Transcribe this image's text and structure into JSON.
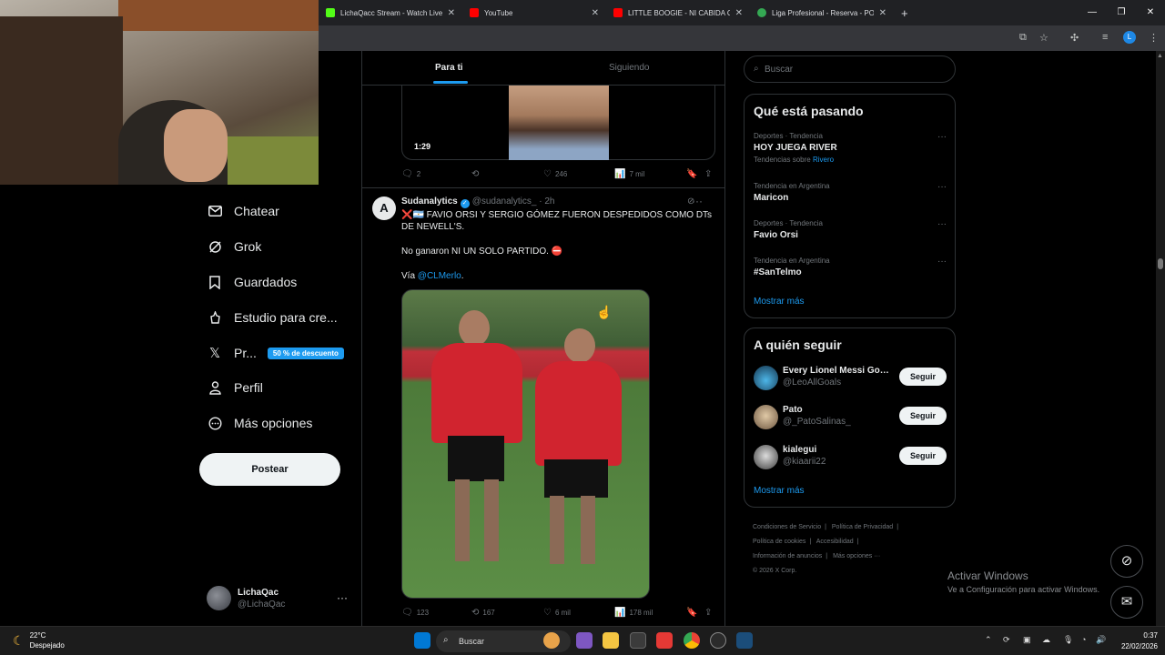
{
  "browser": {
    "tabs": [
      {
        "title": "LichaQacc Stream - Watch Live",
        "color": "#53fc18"
      },
      {
        "title": "YouTube",
        "color": "#ff0000"
      },
      {
        "title": "LITTLE BOOGIE - NI CABIDA CO",
        "color": "#ff0000"
      },
      {
        "title": "Liga Profesional - Reserva - PO",
        "color": "#34a853"
      }
    ],
    "new_tab": "+",
    "profile_initial": "L"
  },
  "nav": {
    "items": [
      {
        "label": "Chatear",
        "icon": "envelope-icon"
      },
      {
        "label": "Grok",
        "icon": "grok-icon"
      },
      {
        "label": "Guardados",
        "icon": "bookmark-icon"
      },
      {
        "label": "Estudio para cre...",
        "icon": "creator-studio-icon"
      },
      {
        "label": "Pr...",
        "icon": "x-logo-icon",
        "badge": "50 % de descuento"
      },
      {
        "label": "Perfil",
        "icon": "person-icon"
      },
      {
        "label": "Más opciones",
        "icon": "more-circle-icon"
      }
    ],
    "post_label": "Postear",
    "account": {
      "name": "LichaQac",
      "handle": "@LichaQac"
    }
  },
  "feed": {
    "tabs": {
      "active": "Para ti",
      "inactive": "Siguiendo"
    },
    "prev_post": {
      "video_time": "1:29",
      "replies": "2",
      "likes": "246",
      "views": "7 mil"
    },
    "post": {
      "avatar_letter": "A",
      "author": "Sudanalytics",
      "handle": "@sudanalytics_",
      "time": "· 2h",
      "line1": "❌🇦🇷 FAVIO ORSI Y SERGIO GÓMEZ FUERON DESPEDIDOS COMO DTs DE NEWELL'S.",
      "line2": "No ganaron NI UN SOLO PARTIDO. ⛔",
      "via_prefix": "Vía ",
      "via_link": "@CLMerlo",
      "via_suffix": ".",
      "replies": "123",
      "reposts": "167",
      "likes": "6 mil",
      "views": "178 mil"
    }
  },
  "search": {
    "placeholder": "Buscar"
  },
  "trends": {
    "title": "Qué está pasando",
    "items": [
      {
        "context": "Deportes · Tendencia",
        "title": "HOY JUEGA RIVER",
        "sub_prefix": "Tendencias sobre ",
        "sub_link": "Rivero"
      },
      {
        "context": "Tendencia en Argentina",
        "title": "Maricon"
      },
      {
        "context": "Deportes · Tendencia",
        "title": "Favio Orsi"
      },
      {
        "context": "Tendencia en Argentina",
        "title": "#SanTelmo"
      }
    ],
    "show_more": "Mostrar más"
  },
  "who_to_follow": {
    "title": "A quién seguir",
    "items": [
      {
        "name": "Every Lionel Messi Goa...",
        "handle": "@LeoAllGoals",
        "button": "Seguir"
      },
      {
        "name": "Pato",
        "handle": "@_PatoSalinas_",
        "button": "Seguir"
      },
      {
        "name": "kialegui",
        "handle": "@kiaarii22",
        "button": "Seguir"
      }
    ],
    "show_more": "Mostrar más"
  },
  "footer": {
    "links": [
      "Condiciones de Servicio",
      "|",
      "Política de Privacidad",
      "|",
      "Política de cookies",
      "|",
      "Accesibilidad",
      "|",
      "Información de anuncios",
      "|",
      "Más opciones ···"
    ],
    "copyright": "© 2026 X Corp."
  },
  "watermark": {
    "line1": "Activar Windows",
    "line2": "Ve a Configuración para activar Windows."
  },
  "taskbar": {
    "weather_temp": "22°C",
    "weather_desc": "Despejado",
    "search_label": "Buscar",
    "time": "0:37",
    "date": "22/02/2026"
  },
  "colors": {
    "accent": "#1d9bf0",
    "background": "#000000",
    "border": "#2f3336"
  }
}
